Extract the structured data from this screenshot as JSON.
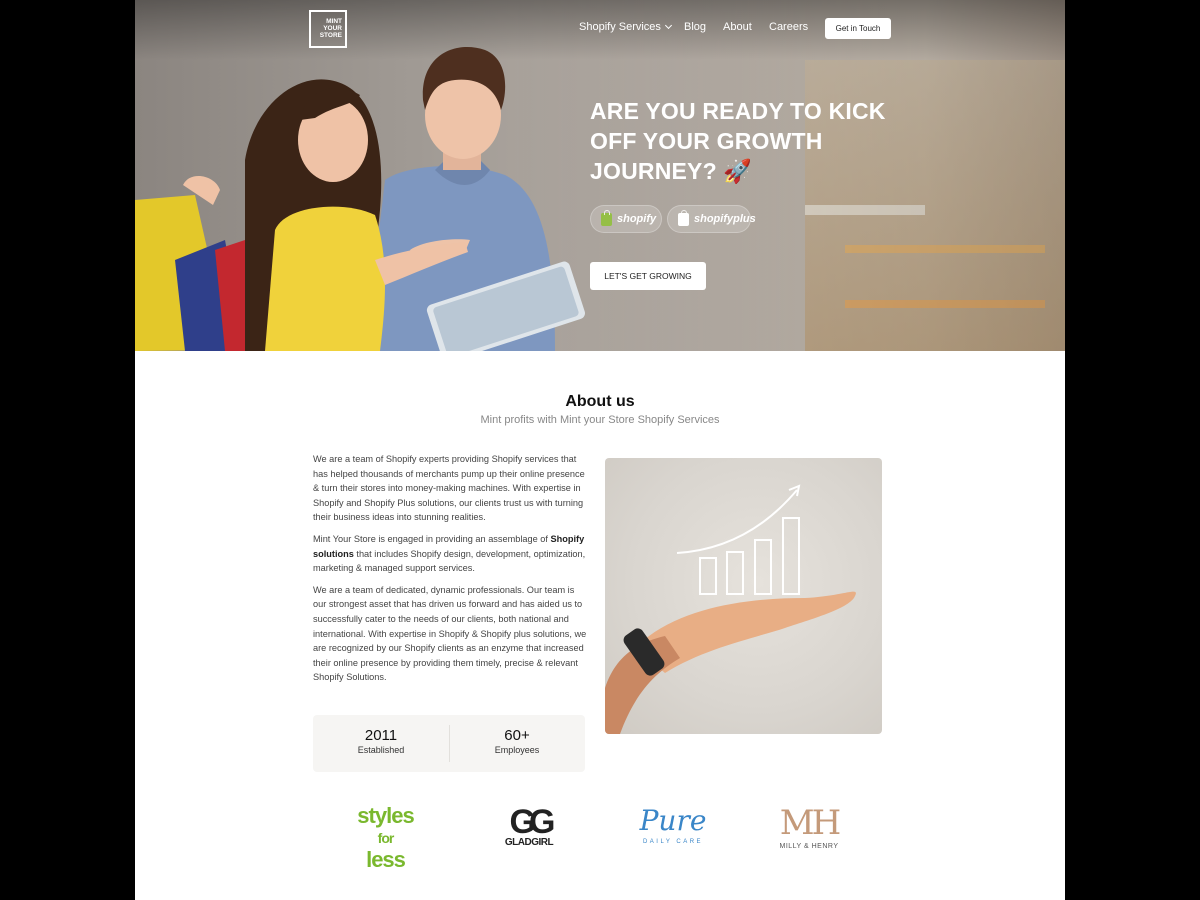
{
  "nav": {
    "logo_lines": [
      "MINT",
      "YOUR",
      "STORE"
    ],
    "items": [
      {
        "label": "Shopify Services"
      },
      {
        "label": "Blog"
      },
      {
        "label": "About"
      },
      {
        "label": "Careers"
      }
    ],
    "cta": "Get in Touch"
  },
  "hero": {
    "title": "ARE YOU READY TO KICK OFF YOUR GROWTH JOURNEY? 🚀",
    "badges": [
      "shopify",
      "shopifyplus"
    ],
    "cta": "LET'S GET GROWING"
  },
  "about": {
    "title": "About us",
    "subtitle": "Mint profits with Mint your Store Shopify Services",
    "p1": "We are a team of Shopify experts providing Shopify services that has helped thousands of merchants pump up their online presence & turn their stores into money-making machines. With expertise in Shopify and Shopify Plus solutions, our clients trust us with turning their business ideas into stunning realities.",
    "p2_pre": "Mint Your Store is engaged in providing an assemblage of ",
    "p2_bold": "Shopify solutions",
    "p2_post": " that includes Shopify design, development, optimization, marketing & managed support services.",
    "p3": "We are a team of dedicated, dynamic professionals. Our team is our strongest asset that has driven us forward and has aided us to successfully cater to the needs of our clients, both national and international. With expertise in Shopify & Shopify plus solutions, we are recognized by our Shopify clients as an enzyme that increased their online presence by providing them timely, precise & relevant Shopify Solutions.",
    "stats": [
      {
        "value": "2011",
        "label": "Established"
      },
      {
        "value": "60+",
        "label": "Employees"
      }
    ]
  },
  "clients": {
    "styles": {
      "line1": "styles",
      "line2": "for",
      "line3": "less"
    },
    "glad": {
      "mark": "GG",
      "name": "GLADGIRL"
    },
    "pure": {
      "name": "Pure",
      "sub": "DAILY CARE"
    },
    "mh": {
      "mark": "MH",
      "name": "MILLY & HENRY"
    }
  },
  "colors": {
    "shopify_green": "#95bf47",
    "styles_green": "#7ab82e",
    "pure_blue": "#3a86c8",
    "mh_gold": "#c49a7a"
  }
}
